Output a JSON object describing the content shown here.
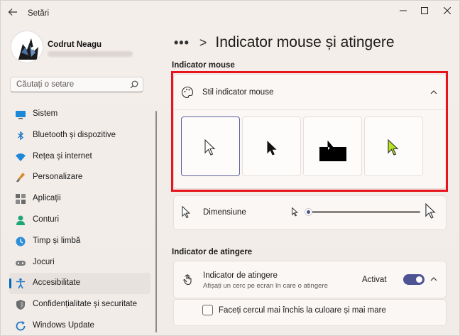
{
  "app_title": "Setări",
  "user": {
    "name": "Codrut Neagu"
  },
  "search": {
    "placeholder": "Căutați o setare"
  },
  "nav_items": [
    {
      "label": "Sistem",
      "icon": "monitor-icon",
      "active": false
    },
    {
      "label": "Bluetooth și dispozitive",
      "icon": "bluetooth-icon",
      "active": false
    },
    {
      "label": "Rețea și internet",
      "icon": "wifi-icon",
      "active": false
    },
    {
      "label": "Personalizare",
      "icon": "brush-icon",
      "active": false
    },
    {
      "label": "Aplicații",
      "icon": "apps-icon",
      "active": false
    },
    {
      "label": "Conturi",
      "icon": "person-icon",
      "active": false
    },
    {
      "label": "Timp și limbă",
      "icon": "clock-globe-icon",
      "active": false
    },
    {
      "label": "Jocuri",
      "icon": "gamepad-icon",
      "active": false
    },
    {
      "label": "Accesibilitate",
      "icon": "accessibility-icon",
      "active": true
    },
    {
      "label": "Confidențialitate și securitate",
      "icon": "shield-icon",
      "active": false
    },
    {
      "label": "Windows Update",
      "icon": "update-icon",
      "active": false
    }
  ],
  "breadcrumb": {
    "dots": "•••",
    "separator": ">",
    "title": "Indicator mouse și atingere"
  },
  "mouse_section": {
    "heading": "Indicator mouse",
    "style_label": "Stil indicator mouse",
    "size_label": "Dimensiune",
    "styles": [
      "alb",
      "negru",
      "inversat",
      "personalizat"
    ],
    "selected_style": "alb",
    "size_level": 0.02
  },
  "touch_section": {
    "heading": "Indicator de atingere",
    "label": "Indicator de atingere",
    "description": "Afișați un cerc pe ecran în care o atingere",
    "toggle_state": "Activat",
    "checkbox_label": "Faceți cercul mai închis la culoare și mai mare"
  },
  "colors": {
    "accent": "#4e5394",
    "highlight_frame": "#e8131b",
    "custom_pointer": "#b5e61d"
  }
}
